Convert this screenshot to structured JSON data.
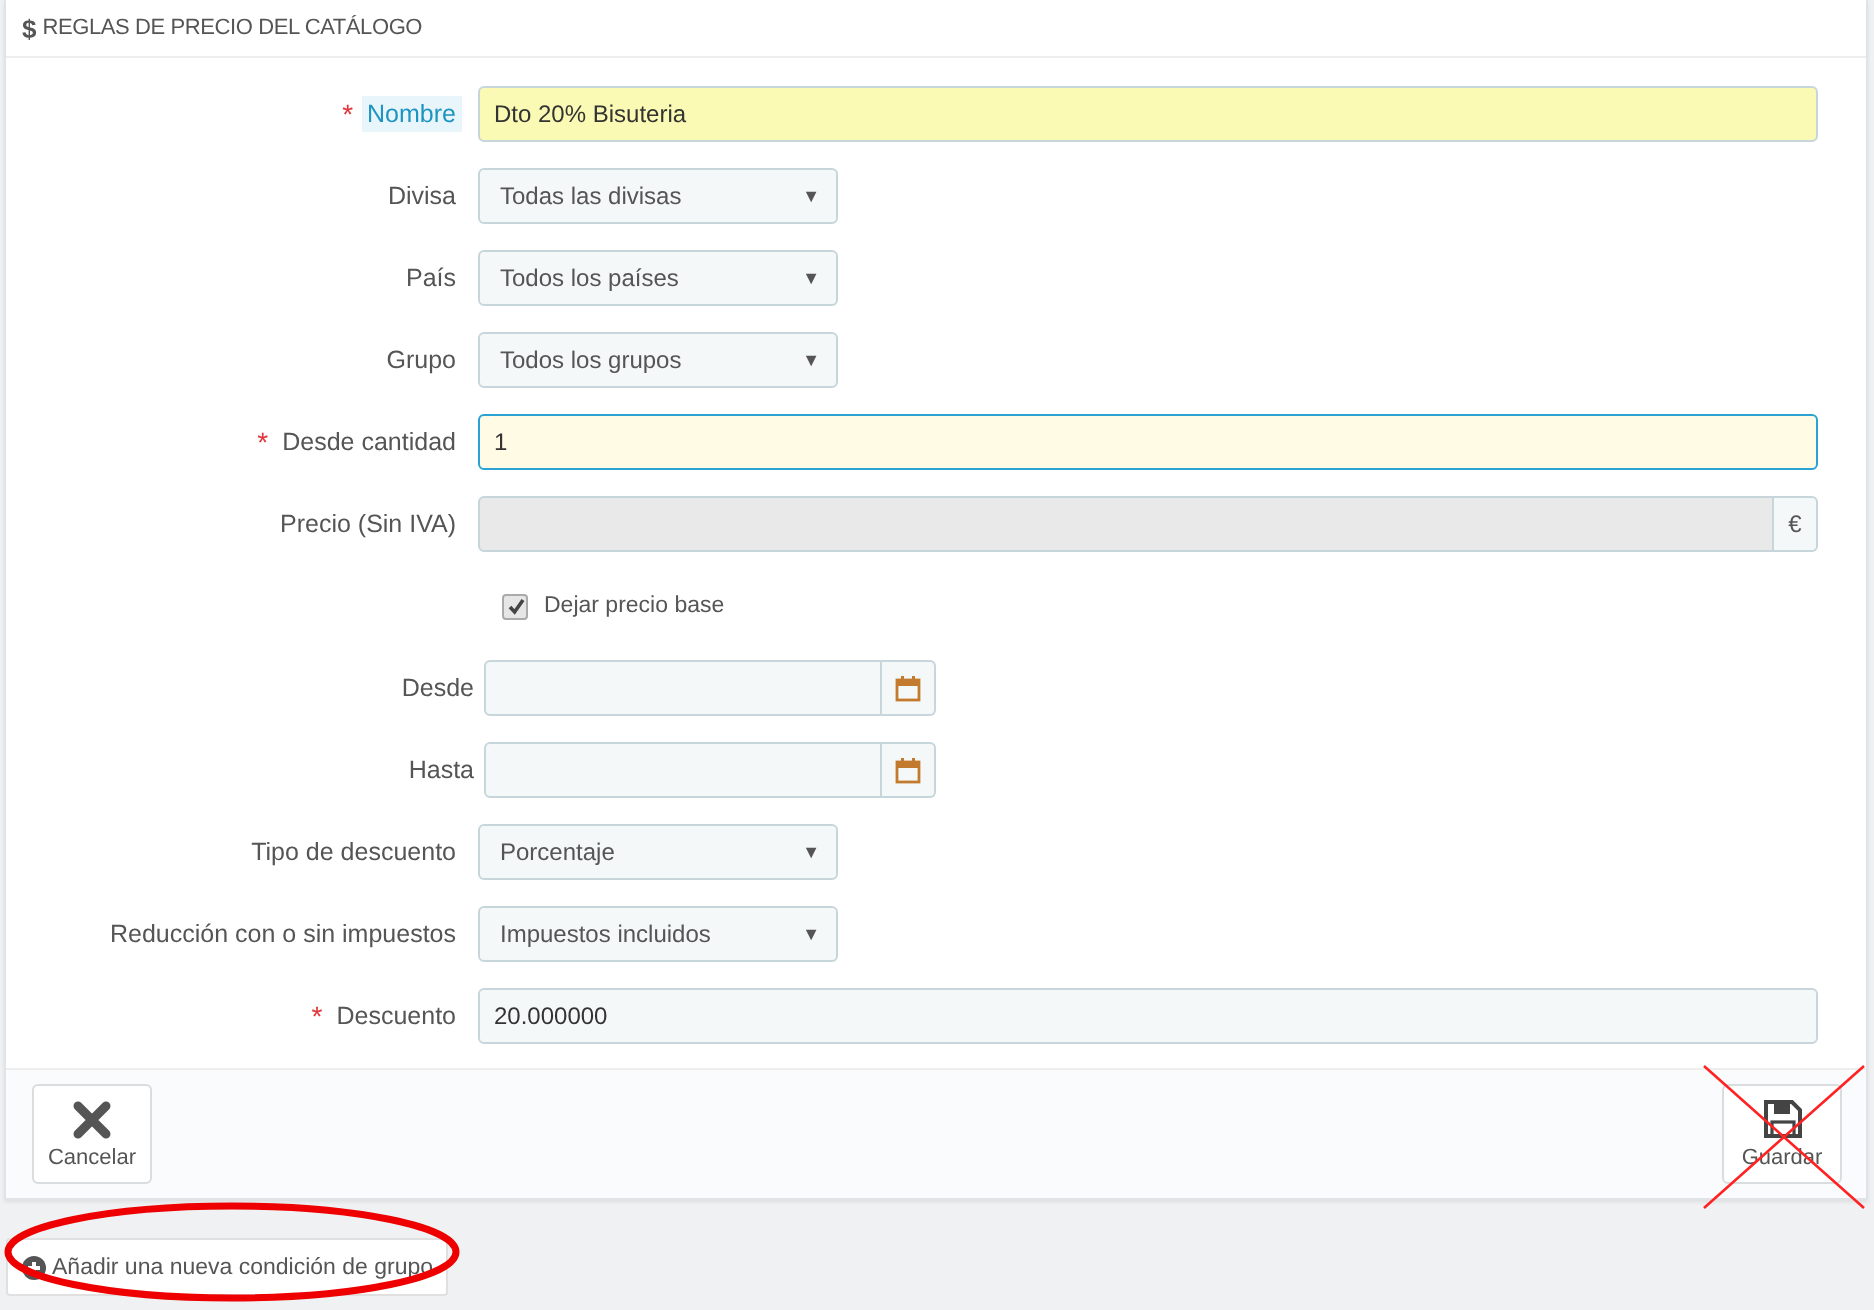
{
  "panel": {
    "icon": "$",
    "title": "REGLAS DE PRECIO DEL CATÁLOGO"
  },
  "fields": [
    {
      "kind": "text",
      "label": "Nombre",
      "required": true,
      "label_highlighted": true,
      "value": "Dto 20% Bisuteria",
      "autofilled": true,
      "focused": false
    },
    {
      "kind": "select",
      "label": "Divisa",
      "required": false,
      "label_highlighted": false,
      "value": "Todas las divisas",
      "caret": "▼"
    },
    {
      "kind": "select",
      "label": "País",
      "required": false,
      "label_highlighted": false,
      "value": "Todos los países",
      "caret": "▼"
    },
    {
      "kind": "select",
      "label": "Grupo",
      "required": false,
      "label_highlighted": false,
      "value": "Todos los grupos",
      "caret": "▼"
    },
    {
      "kind": "text",
      "label": "Desde cantidad",
      "required": true,
      "label_highlighted": false,
      "value": "1",
      "autofilled": false,
      "focused": true
    },
    {
      "kind": "price",
      "label": "Precio (Sin IVA)",
      "required": false,
      "label_highlighted": false,
      "disabled": true,
      "addon": "€"
    },
    {
      "kind": "checkbox",
      "label": "Dejar precio base",
      "checked": true
    },
    {
      "kind": "date",
      "label": "Desde",
      "required": false,
      "label_highlighted": false
    },
    {
      "kind": "date",
      "label": "Hasta",
      "required": false,
      "label_highlighted": false
    },
    {
      "kind": "select",
      "label": "Tipo de descuento",
      "required": false,
      "label_highlighted": false,
      "value": "Porcentaje",
      "caret": "▼"
    },
    {
      "kind": "select",
      "label": "Reducción con o sin impuestos",
      "required": false,
      "label_highlighted": false,
      "value": "Impuestos incluidos",
      "caret": "▼"
    },
    {
      "kind": "text",
      "label": "Descuento",
      "required": true,
      "label_highlighted": false,
      "value": "20.000000",
      "autofilled": false,
      "focused": false
    }
  ],
  "required_mark": "*",
  "footer_buttons": [
    {
      "kind": "cancel",
      "label": "Cancelar"
    },
    {
      "kind": "save",
      "label": "Guardar"
    }
  ],
  "add_condition_button": {
    "label": "Añadir una nueva condición de grupo"
  },
  "annotations": [
    {
      "kind": "ellipse"
    },
    {
      "kind": "cross"
    }
  ]
}
